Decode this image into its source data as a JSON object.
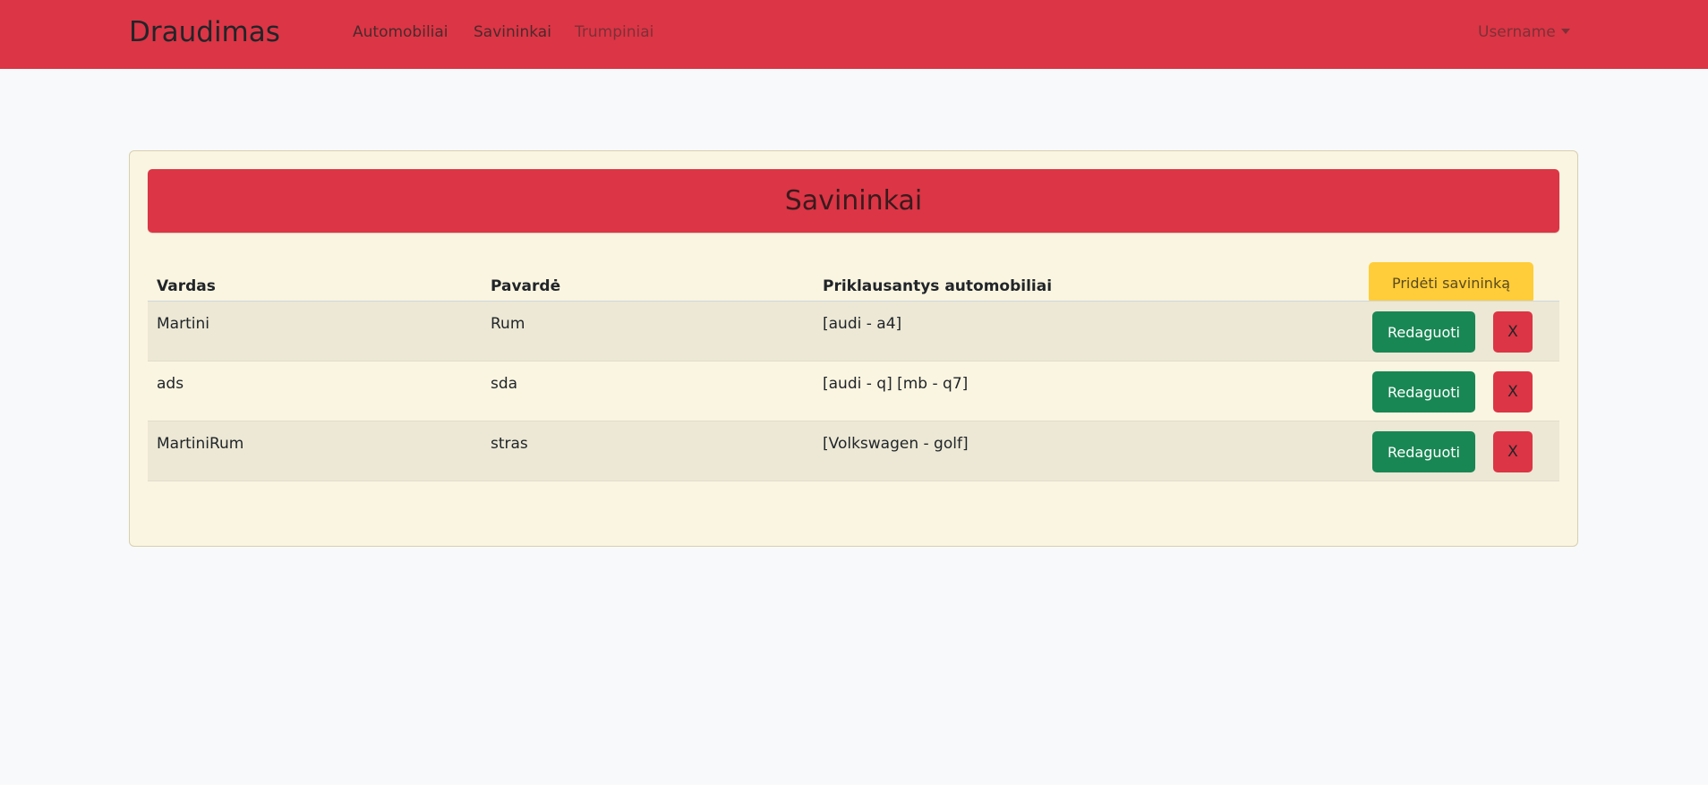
{
  "navbar": {
    "brand": "Draudimas",
    "links": [
      {
        "label": "Automobiliai"
      },
      {
        "label": "Savininkai"
      },
      {
        "label": "Trumpiniai"
      }
    ],
    "user": "Username"
  },
  "card": {
    "title": "Savininkai",
    "add_button": "Pridėti savininką",
    "columns": [
      "Vardas",
      "Pavardė",
      "Priklausantys automobiliai"
    ],
    "rows": [
      {
        "first": "Martini",
        "last": "Rum",
        "cars": "[audi - a4]",
        "edit": "Redaguoti",
        "delete": "X"
      },
      {
        "first": "ads",
        "last": "sda",
        "cars": "[audi - q] [mb - q7]",
        "edit": "Redaguoti",
        "delete": "X"
      },
      {
        "first": "MartiniRum",
        "last": "stras",
        "cars": "[Volkswagen - golf]",
        "edit": "Redaguoti",
        "delete": "X"
      }
    ]
  },
  "colors": {
    "primary_red": "#dc3545",
    "edit_green": "#198754",
    "add_yellow": "#ffcd39",
    "card_bg": "#faf5e1",
    "page_bg": "#f8f9fa"
  }
}
